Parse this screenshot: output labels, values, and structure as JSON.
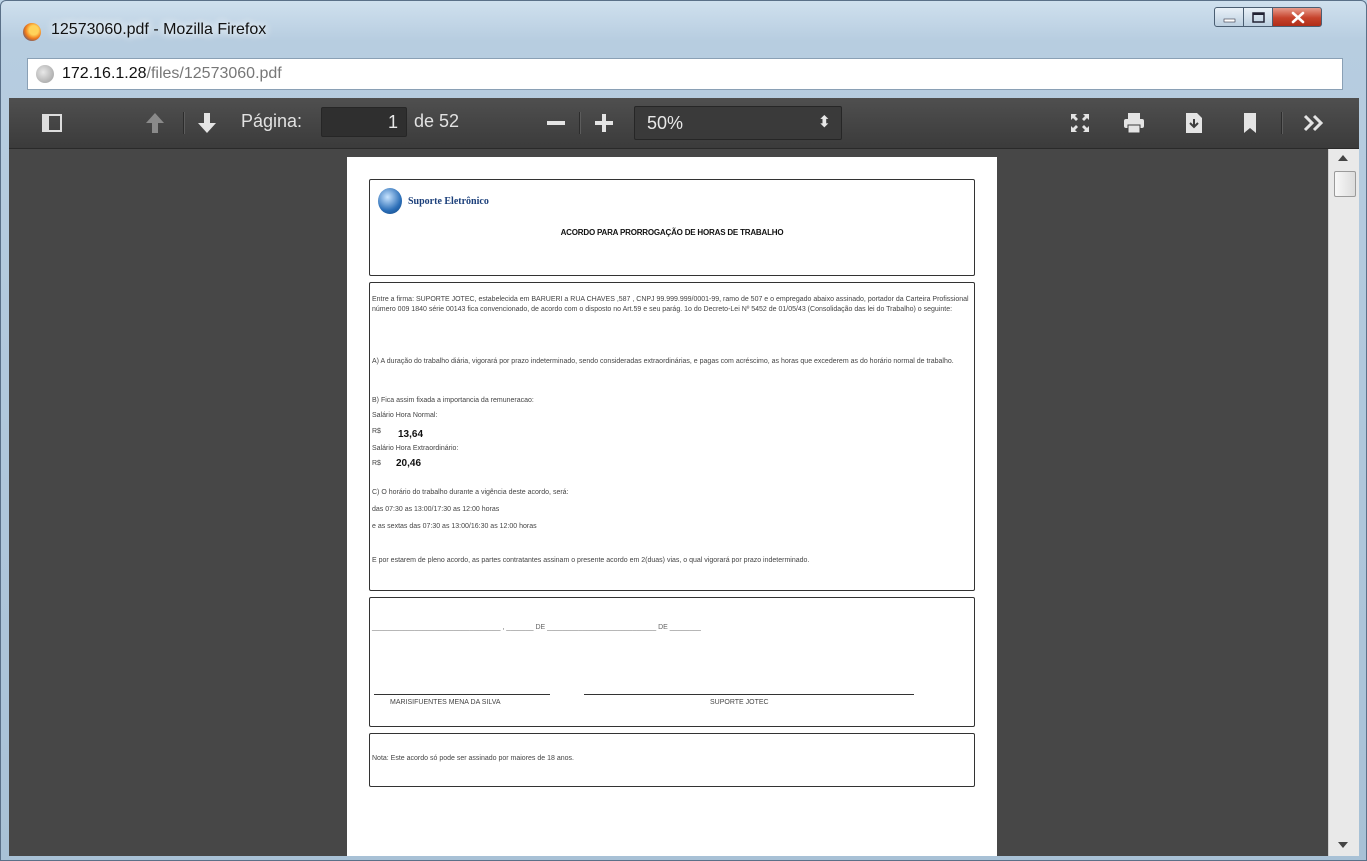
{
  "window": {
    "title": "12573060.pdf - Mozilla Firefox",
    "controls": {
      "minimize": "minimize",
      "maximize": "maximize",
      "close": "close"
    }
  },
  "address": {
    "host": "172.16.1.28",
    "path": "/files/12573060.pdf"
  },
  "toolbar": {
    "page_label": "Página:",
    "page_value": "1",
    "page_total": "de 52",
    "zoom_value": "50%",
    "icons": [
      "sidebar-toggle-icon",
      "page-up-icon",
      "page-down-icon",
      "zoom-out-icon",
      "zoom-in-icon",
      "chevron-up-down-icon",
      "fullscreen-icon",
      "print-icon",
      "download-icon",
      "bookmark-icon",
      "more-tools-icon"
    ]
  },
  "document": {
    "header": {
      "brand": "Suporte Eletrônico",
      "title": "ACORDO PARA PRORROGAÇÃO DE HORAS DE TRABALHO"
    },
    "body": {
      "intro": "Entre a firma: SUPORTE  JOTEC, estabelecida em BARUERI a RUA CHAVES ,587 , CNPJ 99.999.999/0001-99, ramo de 507  e o empregado abaixo assinado, portador da Carteira Profissional número 009 1840 série 00143 fica convencionado, de acordo com o disposto no Art.59 e seu parág. 1o do Decreto-Lei Nº 5452 de 01/05/43 (Consolidação das lei do Trabalho) o seguinte:",
      "clause_a": "A) A duração do trabalho diária, vigorará por prazo indeterminado, sendo consideradas extraordinárias, e pagas com acréscimo, as horas que excederem as do  horário normal de trabalho.",
      "clause_b": "B) Fica assim fixada a importancia da remuneracao:",
      "normal_label": "Salário Hora Normal:",
      "currency": "R$",
      "normal_value": "13,64",
      "extra_label": "Salário Hora Extraordinário:",
      "extra_value": "20,46",
      "clause_c": "C) O horário do trabalho durante a vigência deste acordo, será:",
      "schedule_1": "das 07:30 as 13:00/17:30 as 12:00 horas",
      "schedule_2": "e as sextas das 07:30 as 13:00/16:30 as 12:00 horas",
      "closing": "E por estarem de pleno acordo, as partes contratantes assinam o presente acordo em 2(duas) vias, o qual vigorará por prazo indeterminado."
    },
    "signatures": {
      "date_line": "_________________________________ , _______ DE ____________________________ DE ________",
      "employee": "MARISIFUENTES MENA DA SILVA",
      "company": "SUPORTE  JOTEC"
    },
    "note": "Nota: Este acordo só pode ser assinado por maiores de 18 anos."
  }
}
